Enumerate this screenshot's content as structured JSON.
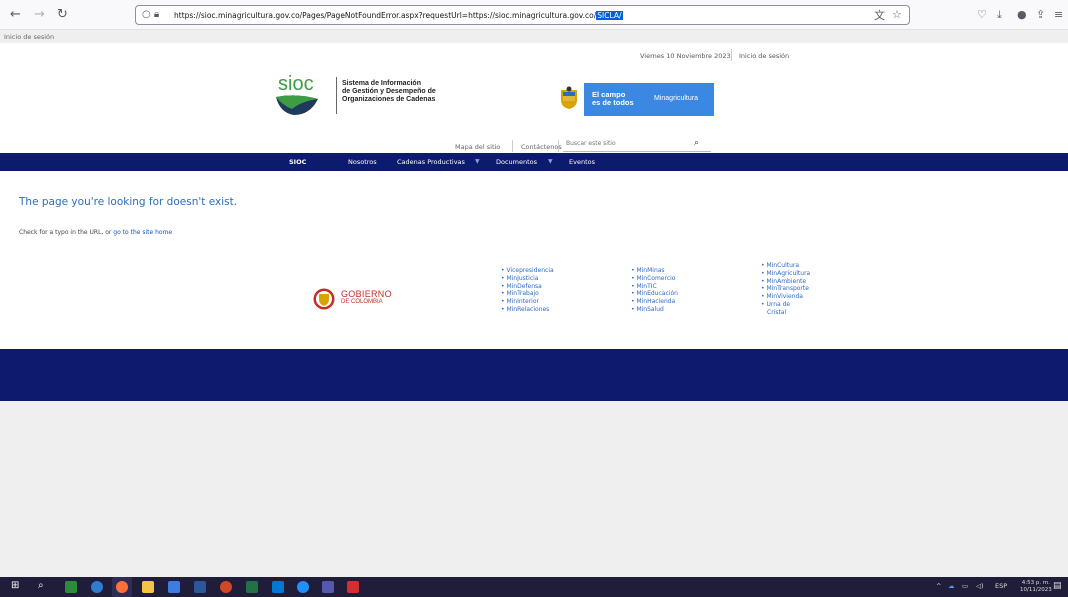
{
  "browser": {
    "url_prefix": "https://sioc.minagricultura.gov.co/Pages/PageNotFoundError.aspx?requestUrl=https://sioc.minagricultura.gov.co/",
    "url_selected": "SICLA/",
    "back_icon": "arrow-left-icon",
    "forward_icon": "arrow-right-icon",
    "reload_icon": "reload-icon"
  },
  "ribbon": {
    "login_label": "Inicio de sesión"
  },
  "header": {
    "date": "Viernes 10 Noviembre 2023",
    "login_link": "Inicio de sesión",
    "sioc_title_line1": "Sistema de Información",
    "sioc_title_line2": "de Gestión y Desempeño de",
    "sioc_title_line3": "Organizaciones de Cadenas",
    "banner_line1": "El campo",
    "banner_line2": "es de todos",
    "banner_ministry": "Minagricultura",
    "logo_text": "sioc"
  },
  "utility": {
    "sitemap": "Mapa del sitio",
    "contact": "Contáctenos",
    "search_placeholder": "Buscar este sitio"
  },
  "mainnav": {
    "items": [
      {
        "label": "SIOC"
      },
      {
        "label": "Nosotros"
      },
      {
        "label": "Cadenas Productivas"
      },
      {
        "label": "Documentos"
      },
      {
        "label": "Eventos"
      }
    ]
  },
  "error": {
    "title": "The page you're looking for doesn't exist.",
    "message_prefix": "Check for a typo in the URL, or ",
    "home_link": "go to the site home"
  },
  "footer": {
    "gobierno_line1": "GOBIERNO",
    "gobierno_line2": "DE COLOMBIA",
    "col1": [
      "Vicepresidencia",
      "MinJusticia",
      "MinDefensa",
      "MinTrabajo",
      "MinInterior",
      "MinRelaciones"
    ],
    "col2": [
      "MinMinas",
      "MinComercio",
      "MinTIC",
      "MinEducación",
      "MinHacienda",
      "MinSalud"
    ],
    "col3": [
      "MinCultura",
      "MinAgricultura",
      "MinAmbiente",
      "MinTransporte",
      "MinVivienda",
      "Urna de",
      "Cristal"
    ]
  },
  "taskbar": {
    "lang": "ESP",
    "time": "4:53 p. m.",
    "date": "10/11/2023"
  },
  "colors": {
    "nav_blue": "#0d1b6f",
    "banner_blue": "#3b88e3",
    "link_blue": "#2b6ac9",
    "gobierno_red": "#c82a2a",
    "sioc_green": "#3e9c45"
  }
}
